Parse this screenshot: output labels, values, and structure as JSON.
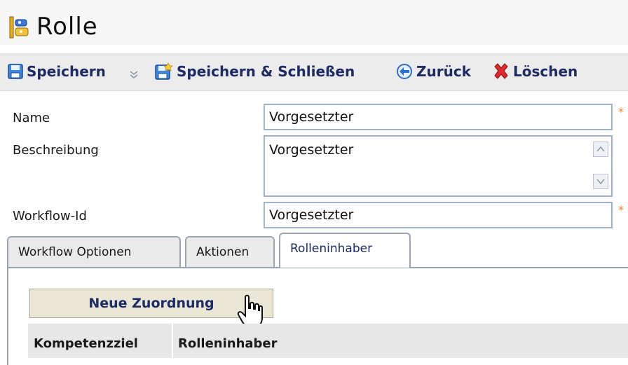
{
  "page": {
    "title": "Rolle",
    "title_icon": "role-icon"
  },
  "toolbar": {
    "save": {
      "label": "Speichern",
      "icon": "save-icon"
    },
    "save_dropdown_icon": "chevron-down-icon",
    "save_close": {
      "label": "Speichern & Schließen",
      "icon": "save-close-icon"
    },
    "back": {
      "label": "Zurück",
      "icon": "back-arrow-icon"
    },
    "delete": {
      "label": "Löschen",
      "icon": "delete-x-icon"
    }
  },
  "form": {
    "name": {
      "label": "Name",
      "value": "Vorgesetzter",
      "required_mark": "*"
    },
    "description": {
      "label": "Beschreibung",
      "value": "Vorgesetzter"
    },
    "workflow_id": {
      "label": "Workflow-Id",
      "value": "Vorgesetzter",
      "required_mark": "*"
    }
  },
  "tabs": [
    {
      "label": "Workflow Optionen",
      "active": false
    },
    {
      "label": "Aktionen",
      "active": false
    },
    {
      "label": "Rolleninhaber",
      "active": true
    }
  ],
  "panel": {
    "new_assignment_label": "Neue Zuordnung",
    "table_headers": [
      "Kompetenzziel",
      "Rolleninhaber"
    ]
  },
  "colors": {
    "toolbar_text": "#1d2b66",
    "input_border": "#9fb2c9",
    "required_star": "#e08a2a",
    "delete_icon": "#d62a2a",
    "button_bg": "#e9e6d6"
  }
}
